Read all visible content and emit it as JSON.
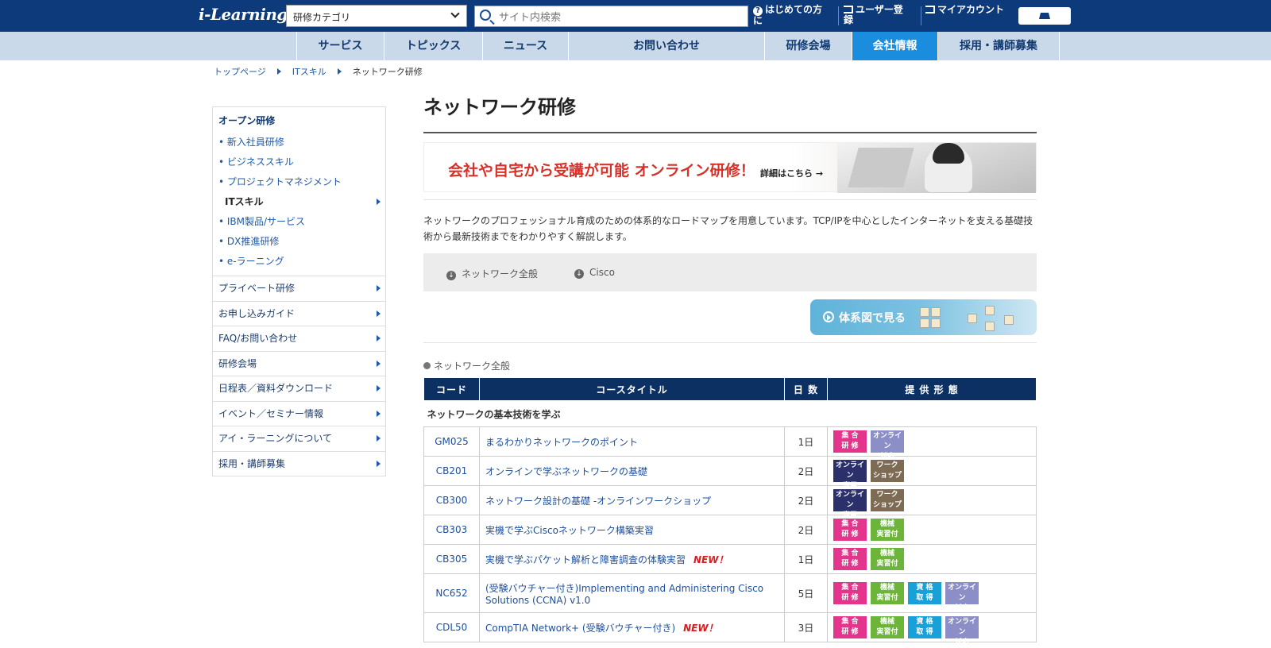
{
  "header": {
    "logo": "i-Learning",
    "category_select": "研修カテゴリ",
    "search_placeholder": "サイト内検索",
    "nav": [
      "はじめての方に",
      "ユーザー登録",
      "マイアカウント"
    ]
  },
  "main_nav": [
    "サービス",
    "トピックス",
    "ニュース",
    "お問い合わせ",
    "研修会場",
    "会社情報",
    "採用・講師募集"
  ],
  "main_nav_active": "会社情報",
  "breadcrumb": [
    "トップページ",
    "ITスキル",
    "ネットワーク研修"
  ],
  "sidebar": {
    "head": "オープン研修",
    "subs": [
      "• 新入社員研修",
      "• ビジネススキル",
      "• プロジェクトマネジメント",
      "ITスキル",
      "• IBM製品/サービス",
      "• DX推進研修",
      "• e-ラーニング"
    ],
    "rows": [
      "プライベート研修",
      "お申し込みガイド",
      "FAQ/お問い合わせ",
      "研修会場",
      "日程表／資料ダウンロード",
      "イベント／セミナー情報",
      "アイ・ラーニングについて",
      "採用・講師募集"
    ]
  },
  "page": {
    "title": "ネットワーク研修",
    "banner_text": "会社や自宅から受講が可能 オンライン研修！",
    "banner_detail": "詳細はこちら →",
    "intro": "ネットワークのプロフェッショナル育成のための体系的なロードマップを用意しています。TCP/IPを中心としたインターネットを支える基礎技術から最新技術までをわかりやすく解説します。",
    "anchors": [
      "ネットワーク全般",
      "Cisco"
    ],
    "chart_button": "体系図で見る",
    "section": "ネットワーク全般",
    "table_headers": [
      "コード",
      "コースタイトル",
      "日 数",
      "提 供 形 態"
    ],
    "group": "ネットワークの基本技術を学ぶ",
    "new_label": "NEW！",
    "tag_labels": {
      "shugo": "集 合\n研 修",
      "online": "オンライン\n対応",
      "onlineonly": "オンライン\n専用",
      "ws": "ワーク\nショップ",
      "kikai": "機械\n実習付",
      "shikaku": "資 格\n取 得"
    },
    "courses": [
      {
        "code": "GM025",
        "title": "まるわかりネットワークのポイント",
        "days": "1日",
        "new": false,
        "tags": [
          "shugo",
          "online"
        ]
      },
      {
        "code": "CB201",
        "title": "オンラインで学ぶネットワークの基礎",
        "days": "2日",
        "new": false,
        "tags": [
          "onlineonly",
          "ws"
        ]
      },
      {
        "code": "CB300",
        "title": "ネットワーク設計の基礎 -オンラインワークショップ",
        "days": "2日",
        "new": false,
        "tags": [
          "onlineonly",
          "ws"
        ]
      },
      {
        "code": "CB303",
        "title": "実機で学ぶCiscoネットワーク構築実習",
        "days": "2日",
        "new": false,
        "tags": [
          "shugo",
          "kikai"
        ]
      },
      {
        "code": "CB305",
        "title": "実機で学ぶパケット解析と障害調査の体験実習",
        "days": "1日",
        "new": true,
        "tags": [
          "shugo",
          "kikai"
        ]
      },
      {
        "code": "NC652",
        "title": "(受験バウチャー付き)Implementing and Administering Cisco Solutions (CCNA) v1.0",
        "days": "5日",
        "new": false,
        "tags": [
          "shugo",
          "kikai",
          "shikaku",
          "online"
        ]
      },
      {
        "code": "CDL50",
        "title": "CompTIA Network+ (受験バウチャー付き)",
        "days": "3日",
        "new": true,
        "tags": [
          "shugo",
          "kikai",
          "shikaku",
          "online"
        ]
      }
    ]
  }
}
